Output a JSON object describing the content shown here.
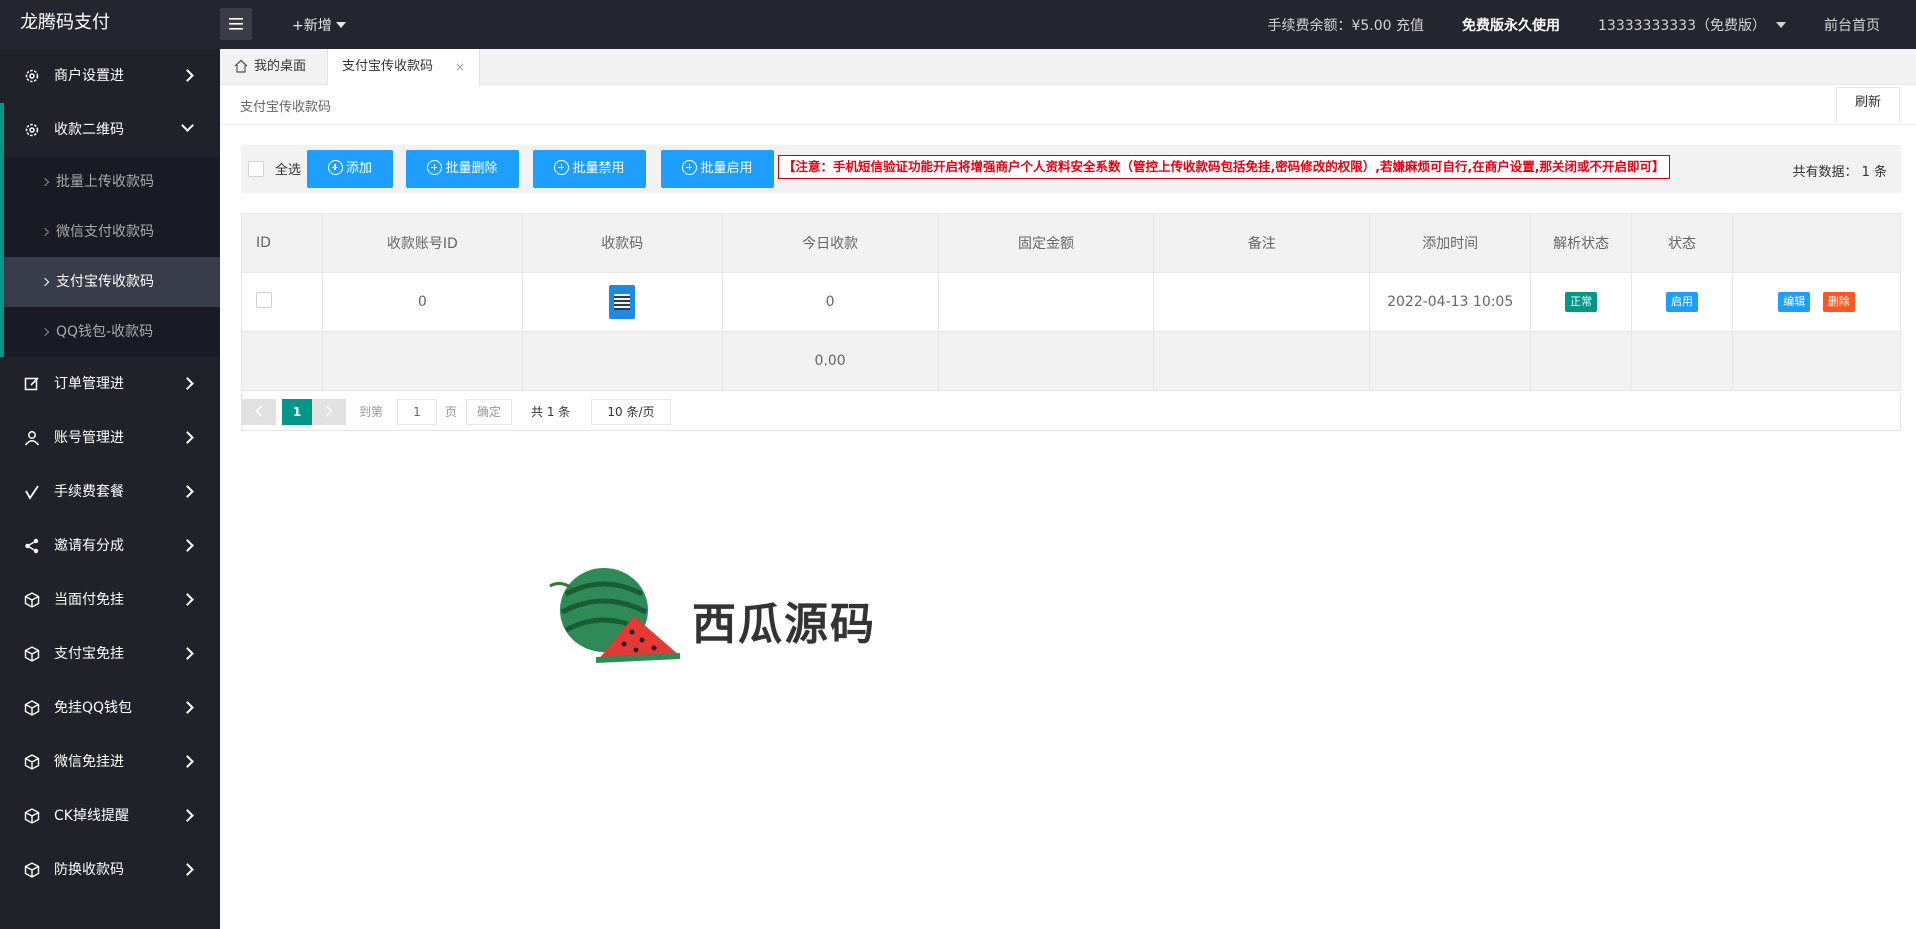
{
  "header": {
    "logo": "龙腾码支付",
    "new_label": "+新增",
    "fee_balance": "手续费余额：¥5.00 充值",
    "free_version": "免费版永久使用",
    "account": "13333333333（免费版）",
    "front_home": "前台首页"
  },
  "sidebar": {
    "items": [
      {
        "label": "商户设置进",
        "icon": "gear-icon"
      },
      {
        "label": "收款二维码",
        "icon": "gear-icon"
      },
      {
        "label": "订单管理进",
        "icon": "edit-icon"
      },
      {
        "label": "账号管理进",
        "icon": "user-icon"
      },
      {
        "label": "手续费套餐",
        "icon": "check-icon"
      },
      {
        "label": "邀请有分成",
        "icon": "share-icon"
      },
      {
        "label": "当面付免挂",
        "icon": "cube-icon"
      },
      {
        "label": "支付宝免挂",
        "icon": "cube-icon"
      },
      {
        "label": "免挂QQ钱包",
        "icon": "cube-icon"
      },
      {
        "label": "微信免挂进",
        "icon": "cube-icon"
      },
      {
        "label": "CK掉线提醒",
        "icon": "cube-icon"
      },
      {
        "label": "防换收款码",
        "icon": "cube-icon"
      }
    ],
    "submenu": [
      {
        "label": "批量上传收款码"
      },
      {
        "label": "微信支付收款码"
      },
      {
        "label": "支付宝传收款码"
      },
      {
        "label": "QQ钱包-收款码"
      }
    ]
  },
  "tabs": {
    "home": "我的桌面",
    "current": "支付宝传收款码",
    "close": "×"
  },
  "page": {
    "title": "支付宝传收款码",
    "refresh": "刷新"
  },
  "toolbar": {
    "select_all": "全选",
    "add": "添加",
    "batch_delete": "批量删除",
    "batch_disable": "批量禁用",
    "batch_enable": "批量启用",
    "notice": "【注意：手机短信验证功能开启将增强商户个人资料安全系数（管控上传收款码包括免挂,密码修改的权限）,若嫌麻烦可自行,在商户设置,那关闭或不开启即可】",
    "total": "共有数据： 1 条"
  },
  "table": {
    "headers": [
      "ID",
      "收款账号ID",
      "收款码",
      "今日收款",
      "固定金额",
      "备注",
      "添加时间",
      "解析状态",
      "状态",
      ""
    ],
    "rows": [
      {
        "account_id": "0",
        "today": "0",
        "fixed": "",
        "remark": "",
        "time": "2022-04-13 10:05",
        "parse_status": "正常",
        "status": "启用",
        "edit": "编辑",
        "delete": "删除"
      }
    ],
    "sum": "0.00"
  },
  "pager": {
    "current": "1",
    "goto": "到第",
    "page_value": "1",
    "page_unit": "页",
    "confirm": "确定",
    "total": "共 1 条",
    "per_page": "10 条/页"
  },
  "watermark": {
    "text": "西瓜源码"
  },
  "colors": {
    "topbar": "#23262e",
    "sidebar": "#20222a",
    "primary_blue": "#1e9fff",
    "teal": "#009688",
    "orange": "#ff5722",
    "notice_red": "#e60012"
  }
}
